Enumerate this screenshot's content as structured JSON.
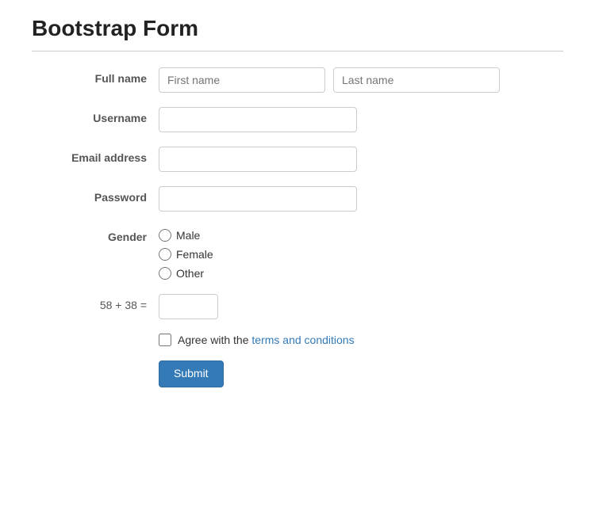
{
  "page": {
    "title": "Bootstrap Form"
  },
  "form": {
    "fullname_label": "Full name",
    "firstname_placeholder": "First name",
    "lastname_placeholder": "Last name",
    "username_label": "Username",
    "email_label": "Email address",
    "password_label": "Password",
    "gender_label": "Gender",
    "gender_options": [
      {
        "label": "Male",
        "value": "male"
      },
      {
        "label": "Female",
        "value": "female"
      },
      {
        "label": "Other",
        "value": "other"
      }
    ],
    "captcha_label": "58 + 38 =",
    "terms_label": "Agree with the terms and conditions",
    "submit_label": "Submit"
  }
}
